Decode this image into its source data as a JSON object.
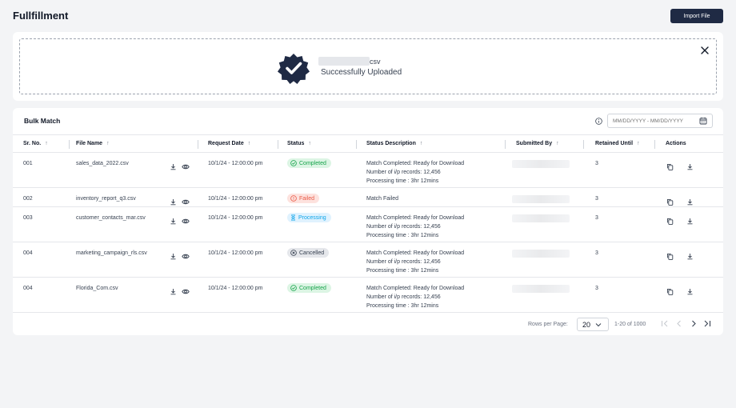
{
  "page": {
    "title": "Fullfillment",
    "import_label": "Import File"
  },
  "upload": {
    "file_ext": "csv",
    "message": "Successfully Uploaded"
  },
  "bulk": {
    "title": "Bulk Match",
    "date_placeholder": "MM/DD/YYYY - MM/DD/YYYY"
  },
  "columns": [
    "Sr. No.",
    "File Name",
    "Request Date",
    "Status",
    "Status Description",
    "Submitted By",
    "Retained Until",
    "Actions"
  ],
  "rows": [
    {
      "sr": "001",
      "file": "sales_data_2022.csv",
      "date": "10/1/24 - 12:00:00 pm",
      "status": "Completed",
      "desc": [
        "Match Completed: Ready for Download",
        "Number of i/p records: 12,456",
        "Processing time : 3hr 12mins"
      ],
      "retained": "3"
    },
    {
      "sr": "002",
      "file": "inventory_report_q3.csv",
      "date": "10/1/24 - 12:00:00 pm",
      "status": "Failed",
      "desc": [
        "Match Failed"
      ],
      "retained": "3"
    },
    {
      "sr": "003",
      "file": "customer_contacts_mar.csv",
      "date": "10/1/24 - 12:00:00 pm",
      "status": "Processing",
      "desc": [
        "Match Completed: Ready for Download",
        "Number of i/p records: 12,456",
        "Processing time : 3hr 12mins"
      ],
      "retained": "3"
    },
    {
      "sr": "004",
      "file": "marketing_campaign_rls.csv",
      "date": "10/1/24 - 12:00:00 pm",
      "status": "Cancelled",
      "desc": [
        "Match Completed: Ready for Download",
        "Number of i/p records: 12,456",
        "Processing time : 3hr 12mins"
      ],
      "retained": "3"
    },
    {
      "sr": "004",
      "file": "Florida_Com.csv",
      "date": "10/1/24 - 12:00:00 pm",
      "status": "Completed",
      "desc": [
        "Match Completed: Ready for Download",
        "Number of i/p records: 12,456",
        "Processing time : 3hr 12mins"
      ],
      "retained": "3"
    }
  ],
  "footer": {
    "rows_label": "Rows per Page:",
    "rows_value": "20",
    "range": "1-20 of 1000"
  },
  "colors": {
    "primary": "#1f2a44",
    "completed": "#16a34a",
    "failed": "#ea5a47",
    "processing": "#0ea5e9",
    "cancelled": "#374151"
  }
}
